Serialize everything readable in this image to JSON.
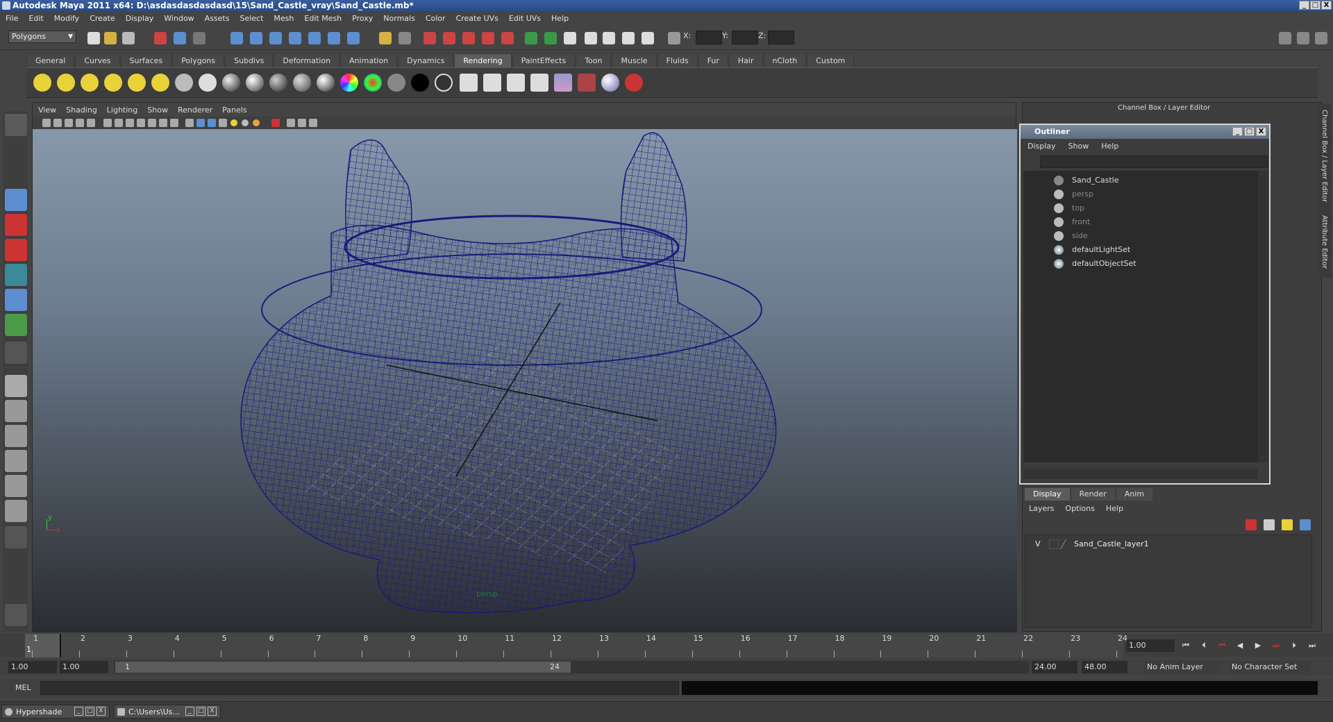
{
  "window": {
    "title": "Autodesk Maya 2011 x64: D:\\asdasdasdasdasd\\15\\Sand_Castle_vray\\Sand_Castle.mb*",
    "min": "_",
    "max": "□",
    "close": "X"
  },
  "menubar": [
    "File",
    "Edit",
    "Modify",
    "Create",
    "Display",
    "Window",
    "Assets",
    "Select",
    "Mesh",
    "Edit Mesh",
    "Proxy",
    "Normals",
    "Color",
    "Create UVs",
    "Edit UVs",
    "Help"
  ],
  "statusline": {
    "mode": "Polygons",
    "x_label": "X:",
    "y_label": "Y:",
    "z_label": "Z:"
  },
  "shelf": {
    "tabs": [
      "General",
      "Curves",
      "Surfaces",
      "Polygons",
      "Subdivs",
      "Deformation",
      "Animation",
      "Dynamics",
      "Rendering",
      "PaintEffects",
      "Toon",
      "Muscle",
      "Fluids",
      "Fur",
      "Hair",
      "nCloth",
      "Custom"
    ],
    "active_tab": "Rendering"
  },
  "viewport": {
    "menu": [
      "View",
      "Shading",
      "Lighting",
      "Show",
      "Renderer",
      "Panels"
    ],
    "camera_label": "persp",
    "axis_x": "x",
    "axis_y": "y"
  },
  "channel_box": {
    "title": "Channel Box / Layer Editor"
  },
  "outliner": {
    "title": "Outliner",
    "menu": [
      "Display",
      "Show",
      "Help"
    ],
    "items": [
      {
        "label": "Sand_Castle",
        "dim": false
      },
      {
        "label": "persp",
        "dim": true
      },
      {
        "label": "top",
        "dim": true
      },
      {
        "label": "front",
        "dim": true
      },
      {
        "label": "side",
        "dim": true
      },
      {
        "label": "defaultLightSet",
        "dim": false
      },
      {
        "label": "defaultObjectSet",
        "dim": false
      }
    ]
  },
  "layer_editor": {
    "tabs": [
      "Display",
      "Render",
      "Anim"
    ],
    "active_tab": "Display",
    "menu": [
      "Layers",
      "Options",
      "Help"
    ],
    "layers": [
      {
        "visible": "V",
        "name": "Sand_Castle_layer1"
      }
    ]
  },
  "side_tabs": [
    "Channel Box / Layer Editor",
    "Attribute Editor"
  ],
  "time_slider": {
    "ticks": [
      "1",
      "2",
      "3",
      "4",
      "5",
      "6",
      "7",
      "8",
      "9",
      "10",
      "11",
      "12",
      "13",
      "14",
      "15",
      "16",
      "17",
      "18",
      "19",
      "20",
      "21",
      "22",
      "23",
      "24"
    ],
    "current_frame": "1.00",
    "playhead_frame": "1"
  },
  "range_slider": {
    "start": "1.00",
    "playback_start": "1.00",
    "range_start_label": "1",
    "range_end_label": "24",
    "playback_end": "24.00",
    "end": "48.00",
    "anim_layer": "No Anim Layer",
    "character_set": "No Character Set"
  },
  "command_line": {
    "label": "MEL"
  },
  "taskbar": [
    {
      "label": "Hypershade"
    },
    {
      "label": "C:\\Users\\Us..."
    }
  ],
  "colors": {
    "wireframe": "#1a1a7a",
    "grid": "#c8c8c8",
    "camera_label": "#1f7a40"
  }
}
